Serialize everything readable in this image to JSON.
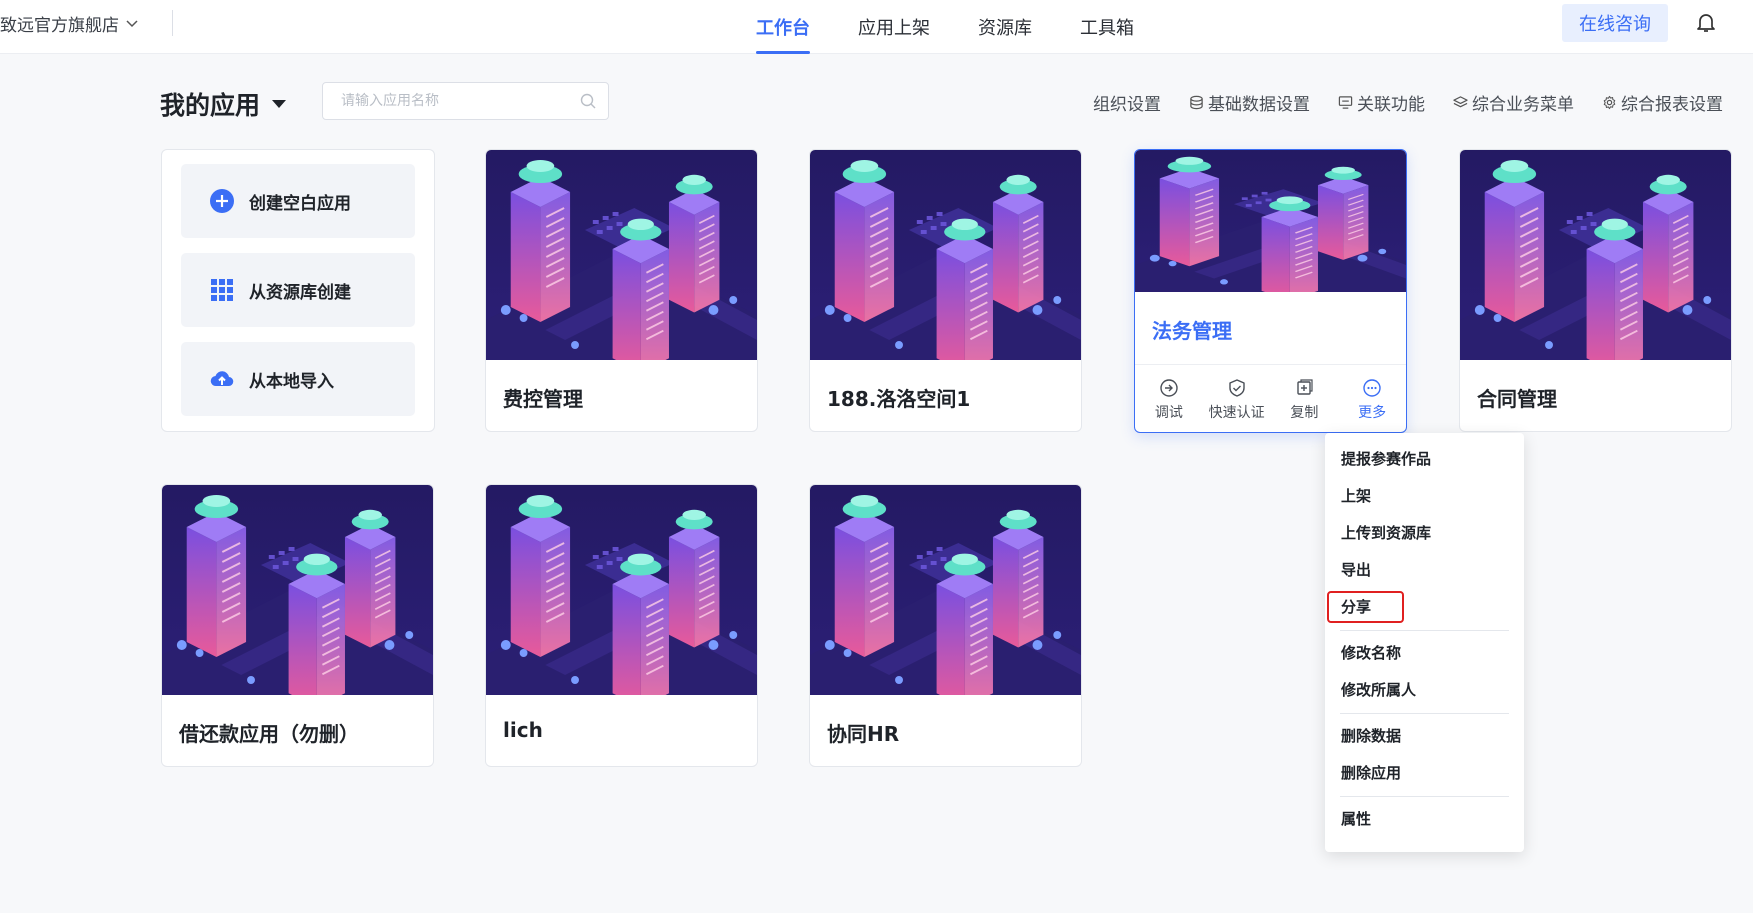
{
  "topbar": {
    "store_name": "致远官方旗舰店",
    "nav": [
      "工作台",
      "应用上架",
      "资源库",
      "工具箱"
    ],
    "active_nav": 0,
    "consult_label": "在线咨询"
  },
  "header": {
    "title": "我的应用",
    "search_placeholder": "请输入应用名称",
    "tools": [
      {
        "label": "组织设置",
        "icon": "none"
      },
      {
        "label": "基础数据设置",
        "icon": "database-icon"
      },
      {
        "label": "关联功能",
        "icon": "link-display-icon"
      },
      {
        "label": "综合业务菜单",
        "icon": "layers-icon"
      },
      {
        "label": "综合报表设置",
        "icon": "gear-icon"
      }
    ]
  },
  "create": {
    "blank": "创建空白应用",
    "from_library": "从资源库创建",
    "import_local": "从本地导入"
  },
  "apps": [
    {
      "title": "费控管理"
    },
    {
      "title": "188.洛洛空间1"
    },
    {
      "title": "法务管理"
    },
    {
      "title": "合同管理"
    },
    {
      "title": "借还款应用（勿删）"
    },
    {
      "title": "lich"
    },
    {
      "title": "协同HR"
    }
  ],
  "card_actions": {
    "debug": "调试",
    "quick_auth": "快速认证",
    "copy": "复制",
    "more": "更多"
  },
  "menu": {
    "groups": [
      [
        "提报参赛作品",
        "上架",
        "上传到资源库",
        "导出",
        "分享"
      ],
      [
        "修改名称",
        "修改所属人"
      ],
      [
        "删除数据",
        "删除应用"
      ],
      [
        "属性"
      ]
    ],
    "highlighted": "分享"
  },
  "colors": {
    "accent": "#3b6ef5",
    "highlight_border": "#e02020"
  }
}
